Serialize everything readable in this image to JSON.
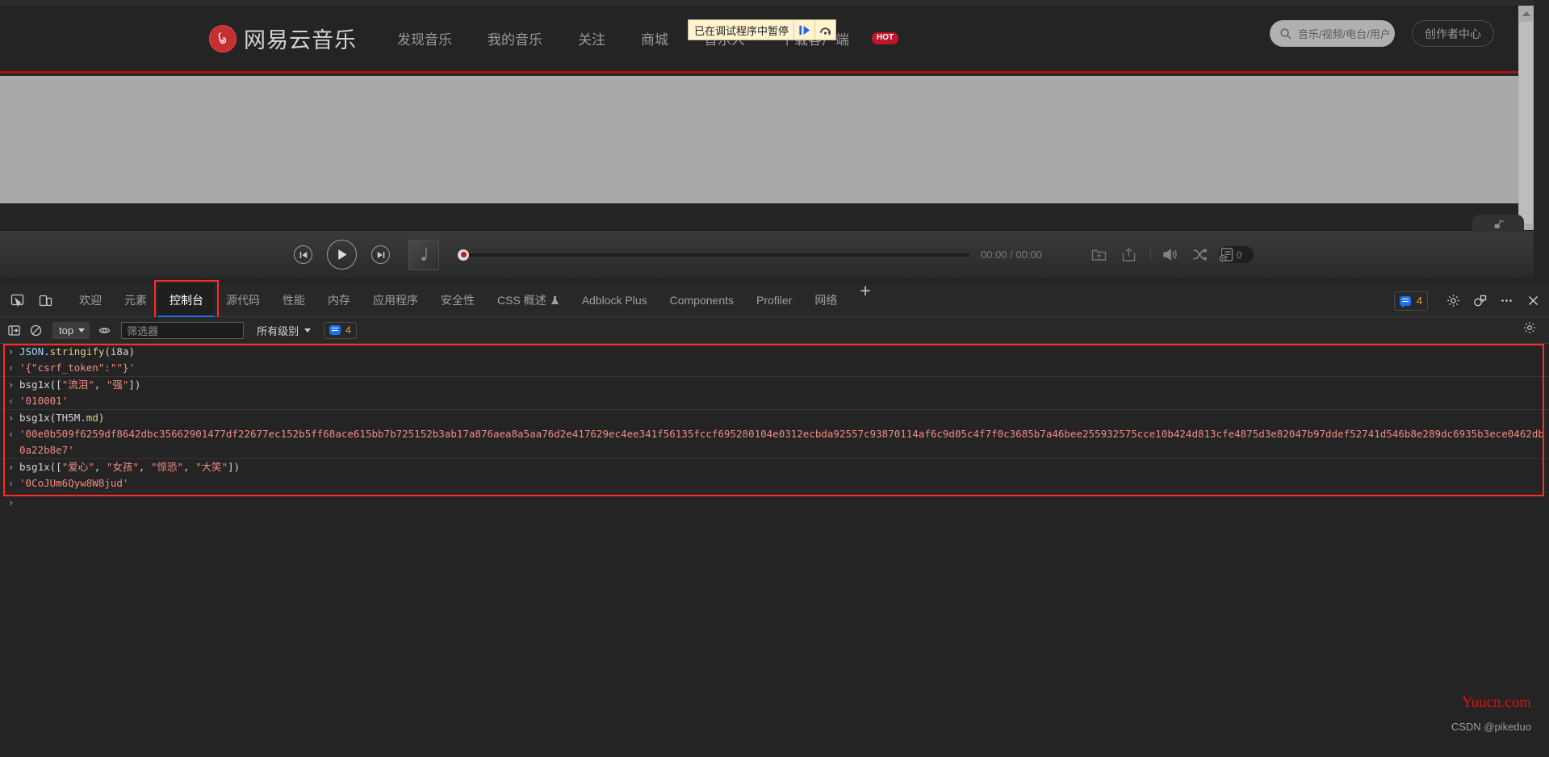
{
  "site": {
    "logo_text": "网易云音乐",
    "nav": [
      {
        "label": "发现音乐"
      },
      {
        "label": "我的音乐"
      },
      {
        "label": "关注"
      },
      {
        "label": "商城"
      },
      {
        "label": "音乐人"
      },
      {
        "label": "下载客户端"
      }
    ],
    "hot_badge": "HOT",
    "search_placeholder": "音乐/视频/电台/用户",
    "creator_center": "创作者中心"
  },
  "debugger_overlay": {
    "message": "已在调试程序中暂停",
    "resume_title": "resume-script-execution",
    "step_title": "step-over-next-function-call"
  },
  "player": {
    "prev": "上一首",
    "play": "播放",
    "next": "下一首",
    "current_time": "00:00",
    "total_time": "00:00",
    "time_display": "00:00 / 00:00",
    "playlist_count": "0"
  },
  "devtools": {
    "tabs": [
      {
        "label": "欢迎",
        "active": false
      },
      {
        "label": "元素",
        "active": false
      },
      {
        "label": "控制台",
        "active": true
      },
      {
        "label": "源代码",
        "active": false
      },
      {
        "label": "性能",
        "active": false
      },
      {
        "label": "内存",
        "active": false
      },
      {
        "label": "应用程序",
        "active": false
      },
      {
        "label": "安全性",
        "active": false
      },
      {
        "label": "CSS 概述",
        "active": false,
        "flask": true
      },
      {
        "label": "Adblock Plus",
        "active": false
      },
      {
        "label": "Components",
        "active": false
      },
      {
        "label": "Profiler",
        "active": false
      },
      {
        "label": "网络",
        "active": false
      }
    ],
    "add_tab": "+",
    "issues_count": "4",
    "console_toolbar": {
      "context": "top",
      "filter_placeholder": "筛选器",
      "level": "所有级别",
      "message_count": "4"
    }
  },
  "console_log": [
    {
      "kind": "input",
      "arrow": "›",
      "tokens": [
        {
          "t": "JSON",
          "c": "obj"
        },
        {
          "t": ".",
          "c": "punc"
        },
        {
          "t": "stringify",
          "c": "fn"
        },
        {
          "t": "(i8a)",
          "c": "punc"
        }
      ],
      "plain": "JSON.stringify(i8a)"
    },
    {
      "kind": "output",
      "arrow": "‹",
      "plain": "'{\"csrf_token\":\"\"}'"
    },
    {
      "kind": "input",
      "arrow": "›",
      "sep": true,
      "tokens": [
        {
          "t": "bsg1x([",
          "c": "plain"
        },
        {
          "t": "\"流泪\"",
          "c": "str"
        },
        {
          "t": ", ",
          "c": "plain"
        },
        {
          "t": "\"强\"",
          "c": "str"
        },
        {
          "t": "])",
          "c": "plain"
        }
      ],
      "plain": "bsg1x([\"流泪\", \"强\"])"
    },
    {
      "kind": "output",
      "arrow": "‹",
      "plain": "'010001'"
    },
    {
      "kind": "input",
      "arrow": "›",
      "sep": true,
      "tokens": [
        {
          "t": "bsg1x(TH5M",
          "c": "plain"
        },
        {
          "t": ".",
          "c": "punc"
        },
        {
          "t": "md",
          "c": "fn"
        },
        {
          "t": ")",
          "c": "plain"
        }
      ],
      "plain": "bsg1x(TH5M.md)"
    },
    {
      "kind": "output",
      "arrow": "‹",
      "plain": "'00e0b509f6259df8642dbc35662901477df22677ec152b5ff68ace615bb7b725152b3ab17a876aea8a5aa76d2e417629ec4ee341f56135fccf695280104e0312ecbda92557c93870114af6c9d05c4f7f0c3685b7a46bee255932575cce10b424d813cfe4875d3e82047b97ddef52741d546b8e289dc6935b3ece0462db0a22b8e7'"
    },
    {
      "kind": "input",
      "arrow": "›",
      "sep": true,
      "tokens": [
        {
          "t": "bsg1x([",
          "c": "plain"
        },
        {
          "t": "\"爱心\"",
          "c": "str"
        },
        {
          "t": ", ",
          "c": "plain"
        },
        {
          "t": "\"女孩\"",
          "c": "str"
        },
        {
          "t": ", ",
          "c": "plain"
        },
        {
          "t": "\"惊恐\"",
          "c": "str"
        },
        {
          "t": ", ",
          "c": "plain"
        },
        {
          "t": "\"大笑\"",
          "c": "str"
        },
        {
          "t": "])",
          "c": "plain"
        }
      ],
      "plain": "bsg1x([\"爱心\", \"女孩\", \"惊恐\", \"大笑\"])"
    },
    {
      "kind": "output",
      "arrow": "‹",
      "plain": "'0CoJUm6Qyw8W8jud'"
    },
    {
      "kind": "prompt",
      "arrow": "›",
      "sep": true,
      "plain": ""
    }
  ],
  "watermark": {
    "red": "Yuucn.com",
    "gray": "CSDN @pikeduo"
  },
  "colors": {
    "brand_red": "#c62f2f",
    "header_underline": "#a01414",
    "accent_blue": "#1a73e8",
    "highlight_red": "#ff2a2a",
    "console_string": "#f28b82",
    "watermark_red": "#e01010"
  }
}
